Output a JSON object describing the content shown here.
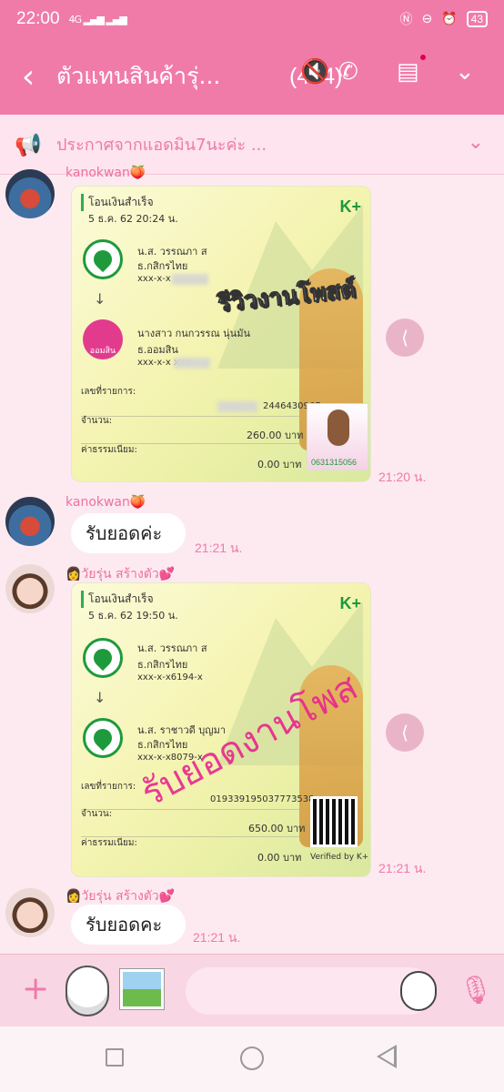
{
  "status_bar": {
    "time": "22:00",
    "network": "4G",
    "battery": "43"
  },
  "header": {
    "title": "ตัวแทนสินค้ารุ่...",
    "member_count": "(454)"
  },
  "announcement": {
    "text": "ประกาศจากแอดมิน7นะค่ะ ..."
  },
  "messages": [
    {
      "type": "image",
      "sender": "kanokwan🍑",
      "time": "21:20 น.",
      "receipt": {
        "title": "โอนเงินสำเร็จ",
        "date": "5 ธ.ค. 62  20:24 น.",
        "brand": "K+",
        "from_name": "น.ส. วรรณภา ส",
        "from_bank": "ธ.กสิกรไทย",
        "from_acct": "xxx-x-x",
        "to_name": "นางสาว กนกวรรณ นุ่นมัน",
        "to_bank": "ธ.ออมสิน",
        "to_acct": "xxx-x-x          xxx",
        "ref_label": "เลขที่รายการ:",
        "ref": "2446430967",
        "amount_label": "จำนวน:",
        "amount": "260.00 บาท",
        "fee_label": "ค่าธรรมเนียม:",
        "fee": "0.00 บาท",
        "overlay": "รีวิวงานโพสต์",
        "gsb_logo": "ออมสิน",
        "promo_phone": "0631315056"
      }
    },
    {
      "type": "text",
      "sender": "kanokwan🍑",
      "text": "รับยอดค่ะ",
      "time": "21:21 น."
    },
    {
      "type": "image",
      "sender": "👩วัยรุ่น สร้างตัว💕",
      "time": "21:21 น.",
      "receipt": {
        "title": "โอนเงินสำเร็จ",
        "date": "5 ธ.ค. 62  19:50 น.",
        "brand": "K+",
        "from_name": "น.ส. วรรณภา ส",
        "from_bank": "ธ.กสิกรไทย",
        "from_acct": "xxx-x-x6194-x",
        "to_name": "น.ส. ราชาวดี บุญมา",
        "to_bank": "ธ.กสิกรไทย",
        "to_acct": "xxx-x-x8079-x",
        "ref_label": "เลขที่รายการ:",
        "ref": "019339195037773538",
        "amount_label": "จำนวน:",
        "amount": "650.00 บาท",
        "fee_label": "ค่าธรรมเนียม:",
        "fee": "0.00 บาท",
        "overlay": "รับยอดงานโพส",
        "qr_label": "Verified by K+"
      }
    },
    {
      "type": "text",
      "sender": "👩วัยรุ่น สร้างตัว💕",
      "text": "รับยอดคะ",
      "time": "21:21 น."
    }
  ],
  "input": {
    "placeholder": ""
  },
  "colors": {
    "primary": "#f07ba9",
    "accent": "#ee7aa8",
    "chat_bg": "#fdeaf1",
    "kbank_green": "#1e9a3c"
  },
  "icons": [
    "back-icon",
    "mute-icon",
    "phone-icon",
    "notes-icon",
    "chevron-down-icon",
    "megaphone-icon",
    "share-icon",
    "plus-icon",
    "sticker-icon",
    "photo-icon",
    "emoji-icon",
    "mic-icon"
  ]
}
